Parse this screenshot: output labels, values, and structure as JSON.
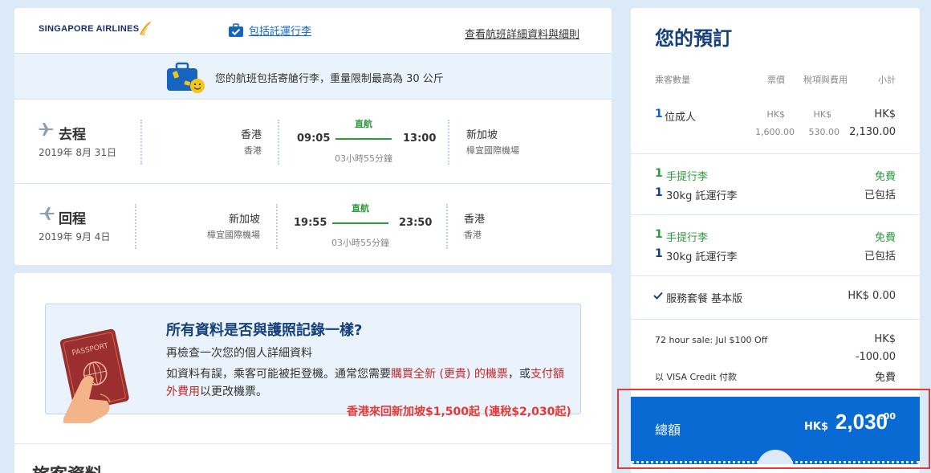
{
  "flight": {
    "airline_logo_text": "SINGAPORE AIRLINES",
    "baggage_link": "包括託運行李",
    "details_link": "查看航班詳細資料與細則",
    "baggage_note": "您的航班包括寄艙行李，重量限制最高為 30 公斤",
    "outbound": {
      "direction": "去程",
      "date": "2019年 8月 31日",
      "from_city": "香港",
      "from_airport": "香港",
      "dep_time": "09:05",
      "stops": "直航",
      "duration": "03小時55分鐘",
      "arr_time": "13:00",
      "to_city": "新加坡",
      "to_airport": "樟宜國際機場"
    },
    "return": {
      "direction": "回程",
      "date": "2019年 9月 4日",
      "from_city": "新加坡",
      "from_airport": "樟宜國際機場",
      "dep_time": "19:55",
      "stops": "直航",
      "duration": "03小時55分鐘",
      "arr_time": "23:50",
      "to_city": "香港",
      "to_airport": "香港"
    }
  },
  "passport": {
    "title": "所有資料是否與護照記錄一樣?",
    "subtitle": "再檢查一次您的個人詳細資料",
    "body_1": "如資料有誤，乘客可能被拒登機。通常您需要",
    "body_red_1": "購買全新 (更貴) 的機票",
    "body_2": "，或",
    "body_red_2": "支付額外費用",
    "body_3": "以更改機票。",
    "art_label": "PASSPORT",
    "next_section": "旅客資料"
  },
  "promo": "香港來回新加坡$1,500起 (連稅$2,030起)",
  "booking": {
    "title": "您的預訂",
    "headers": {
      "pax": "乘客數量",
      "fare": "票價",
      "tax": "稅項與費用",
      "subtotal": "小計"
    },
    "pax_count": "1",
    "pax_label": "位成人",
    "fare_cur": "HK$",
    "fare_amt": "1,600.00",
    "tax_cur": "HK$",
    "tax_amt": "530.00",
    "sub_cur": "HK$",
    "sub_amt": "2,130.00",
    "bag_groups": [
      {
        "hand_qty": "1",
        "hand_label": "手提行李",
        "hand_price": "免費",
        "check_qty": "1",
        "check_label": "30kg 託運行李",
        "check_price": "已包括"
      },
      {
        "hand_qty": "1",
        "hand_label": "手提行李",
        "hand_price": "免費",
        "check_qty": "1",
        "check_label": "30kg 託運行李",
        "check_price": "已包括"
      }
    ],
    "service_label": "服務套餐 基本版",
    "service_price": "HK$ 0.00",
    "sale_label": "72 hour sale: Jul $100 Off",
    "sale_cur": "HK$",
    "sale_amt": "-100.00",
    "pay_label": "以 VISA Credit 付款",
    "pay_price": "免費",
    "total_label": "總額",
    "total_cur": "HK$",
    "total_amt": "2,030",
    "total_dec": ".00"
  },
  "colors": {
    "accent": "#0a6ad3",
    "title_blue": "#15407a",
    "green": "#2e9a3e",
    "red": "#e53935",
    "bg": "#dce9f6"
  }
}
